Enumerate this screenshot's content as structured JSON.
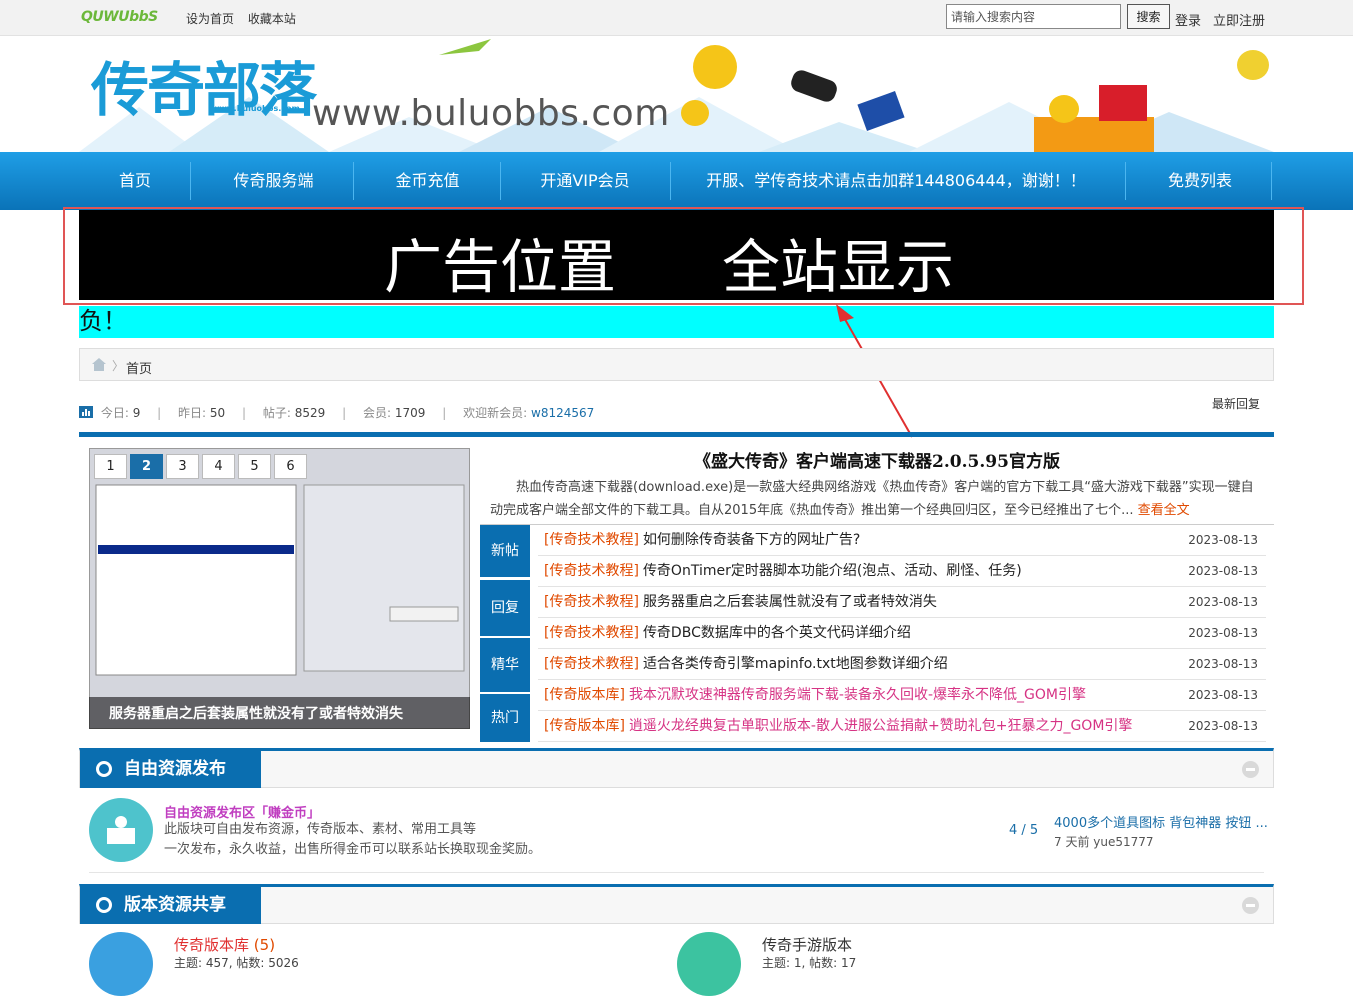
{
  "topbar": {
    "logo": "QUWUbbS",
    "links": [
      "设为首页",
      "收藏本站"
    ],
    "search_placeholder": "请输入搜索内容",
    "search_button": "搜索",
    "login": "登录",
    "register": "立即注册"
  },
  "banner": {
    "brand": "传奇部落",
    "brand_sub": "www.buluobbs.com",
    "url": "www.buluobbs.com"
  },
  "nav": [
    "首页",
    "传奇服务端",
    "金币充值",
    "开通VIP会员",
    "开服、学传奇技术请点击加群144806444，谢谢！！",
    "免费列表"
  ],
  "ad": {
    "left": "广告位置",
    "right": "全站显示"
  },
  "marquee": "负！",
  "breadcrumb": {
    "current": "首页"
  },
  "stats": {
    "today_label": "今日:",
    "today": "9",
    "yesterday_label": "昨日:",
    "yesterday": "50",
    "posts_label": "帖子:",
    "posts": "8529",
    "members_label": "会员:",
    "members": "1709",
    "welcome_label": "欢迎新会员:",
    "new_member": "w8124567",
    "latest": "最新回复"
  },
  "slideshow": {
    "tabs": [
      "1",
      "2",
      "3",
      "4",
      "5",
      "6"
    ],
    "active_tab": 1,
    "caption": "服务器重启之后套装属性就没有了或者特效消失"
  },
  "headline": {
    "title": "《盛大传奇》客户端高速下载器2.0.5.95官方版",
    "summary": "热血传奇高速下载器(download.exe)是一款盛大经典网络游戏《热血传奇》客户端的官方下载工具“盛大游戏下载器”实现一键自动完成客户端全部文件的下载工具。自从2015年底《热血传奇》推出第一个经典回归区，至今已经推出了七个...",
    "more": "查看全文"
  },
  "side_tabs": [
    "新帖",
    "回复",
    "精华",
    "热门"
  ],
  "posts": [
    {
      "tag": "[传奇技术教程]",
      "title": "如何删除传奇装备下方的网址广告?",
      "date": "2023-08-13",
      "pink": false
    },
    {
      "tag": "[传奇技术教程]",
      "title": "传奇OnTimer定时器脚本功能介绍(泡点、活动、刷怪、任务)",
      "date": "2023-08-13",
      "pink": false
    },
    {
      "tag": "[传奇技术教程]",
      "title": "服务器重启之后套装属性就没有了或者特效消失",
      "date": "2023-08-13",
      "pink": false
    },
    {
      "tag": "[传奇技术教程]",
      "title": "传奇DBC数据库中的各个英文代码详细介绍",
      "date": "2023-08-13",
      "pink": false
    },
    {
      "tag": "[传奇技术教程]",
      "title": "适合各类传奇引擎mapinfo.txt地图参数详细介绍",
      "date": "2023-08-13",
      "pink": false
    },
    {
      "tag": "[传奇版本库]",
      "title": "我本沉默攻速神器传奇服务端下载-装备永久回收-爆率永不降低_GOM引擎",
      "date": "2023-08-13",
      "pink": true
    },
    {
      "tag": "[传奇版本库]",
      "title": "逍遥火龙经典复古单职业版本-散人进服公益捐献+赞助礼包+狂暴之力_GOM引擎",
      "date": "2023-08-13",
      "pink": true
    }
  ],
  "section1": {
    "title": "自由资源发布区",
    "forum": {
      "name": "自由资源发布区「赚金币」",
      "desc1": "此版块可自由发布资源，传奇版本、素材、常用工具等",
      "desc2": "一次发布，永久收益，出售所得金币可以联系站长换取现金奖励。",
      "count": "4 / 5",
      "last_title": "4000多个道具图标 背包神器 按钮 ...",
      "last_meta": "7 天前 yue51777"
    }
  },
  "section2": {
    "title": "版本资源共享区",
    "forums": [
      {
        "name": "传奇版本库",
        "new": "(5)",
        "meta": "主题: 457, 帖数: 5026"
      },
      {
        "name": "传奇手游版本",
        "new": "",
        "meta": "主题: 1, 帖数: 17"
      }
    ]
  },
  "colors": {
    "nav": "#0a73b8",
    "accent": "#0a6eb0",
    "tag": "#e04a00",
    "marquee": "#00ffff"
  }
}
